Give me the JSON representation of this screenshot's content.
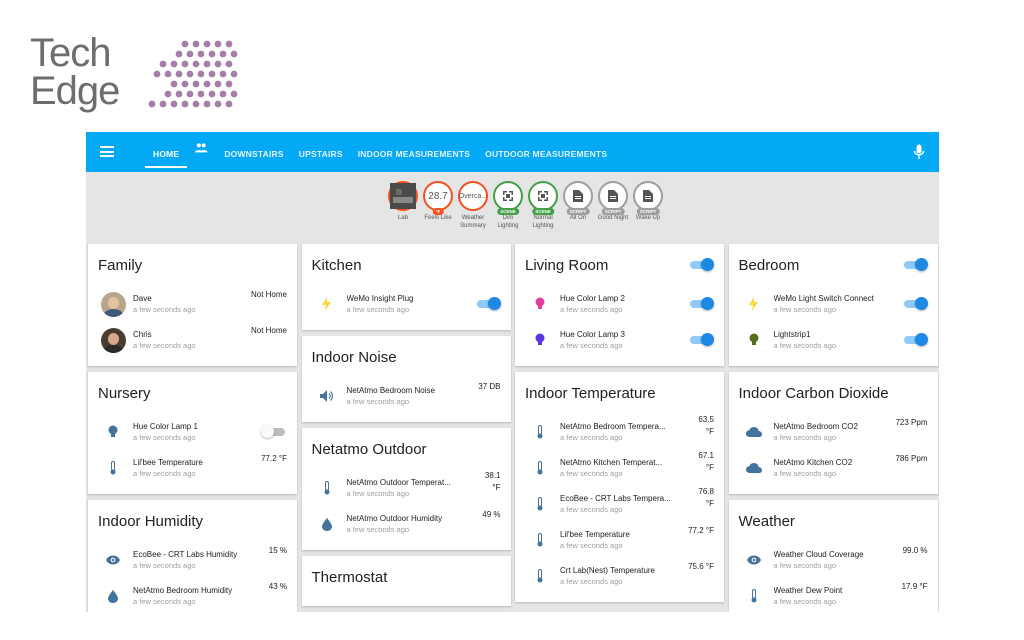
{
  "logo": {
    "line1": "Tech",
    "line2": "Edge"
  },
  "tabs": [
    {
      "label": "HOME"
    },
    {
      "label": "DOWNSTAIRS"
    },
    {
      "label": "UPSTAIRS"
    },
    {
      "label": "INDOOR MEASUREMENTS"
    },
    {
      "label": "OUTDOOR MEASUREMENTS"
    }
  ],
  "badges": [
    {
      "value": "",
      "tag": "",
      "label": "Lab",
      "style": "photo"
    },
    {
      "value": "28.7",
      "tag": "°F",
      "label": "Feels Like",
      "style": "red"
    },
    {
      "value": "Overca...",
      "tag": "",
      "label": "Weather Summary",
      "style": "red"
    },
    {
      "value": "",
      "tag": "SCENE",
      "label": "Dim Lighting",
      "style": "green"
    },
    {
      "value": "",
      "tag": "SCENE",
      "label": "Normal Lighting",
      "style": "green"
    },
    {
      "value": "",
      "tag": "SCRIPT",
      "label": "All On",
      "style": "gray"
    },
    {
      "value": "",
      "tag": "SCRIPT",
      "label": "Good Night",
      "style": "gray"
    },
    {
      "value": "",
      "tag": "SCRIPT",
      "label": "Wake Up",
      "style": "gray"
    }
  ],
  "cards": {
    "family": {
      "title": "Family",
      "rows": [
        {
          "name": "Dave",
          "time": "a few seconds ago",
          "state": "Not Home"
        },
        {
          "name": "Chris",
          "time": "a few seconds ago",
          "state": "Not Home"
        }
      ]
    },
    "nursery": {
      "title": "Nursery",
      "rows": [
        {
          "name": "Hue Color Lamp 1",
          "time": "a few seconds ago",
          "state": "off"
        },
        {
          "name": "Lil'bee Temperature",
          "time": "a few seconds ago",
          "state": "77.2 °F"
        }
      ]
    },
    "humidity": {
      "title": "Indoor Humidity",
      "rows": [
        {
          "name": "EcoBee - CRT Labs Humidity",
          "time": "a few seconds ago",
          "state": "15 %"
        },
        {
          "name": "NetAtmo Bedroom Humidity",
          "time": "a few seconds ago",
          "state": "43 %"
        }
      ]
    },
    "kitchen": {
      "title": "Kitchen",
      "rows": [
        {
          "name": "WeMo Insight Plug",
          "time": "a few seconds ago",
          "state": "on"
        }
      ]
    },
    "noise": {
      "title": "Indoor Noise",
      "rows": [
        {
          "name": "NetAtmo Bedroom Noise",
          "time": "a few seconds ago",
          "state": "37 DB"
        }
      ]
    },
    "outdoor": {
      "title": "Netatmo Outdoor",
      "rows": [
        {
          "name": "NetAtmo Outdoor Temperat...",
          "time": "a few seconds ago",
          "state1": "38.1",
          "state2": "°F"
        },
        {
          "name": "NetAtmo Outdoor Humidity",
          "time": "a few seconds ago",
          "state": "49 %"
        }
      ]
    },
    "thermostat": {
      "title": "Thermostat"
    },
    "living": {
      "title": "Living Room",
      "rows": [
        {
          "name": "Hue Color Lamp 2",
          "time": "a few seconds ago",
          "state": "on"
        },
        {
          "name": "Hue Color Lamp 3",
          "time": "a few seconds ago",
          "state": "on"
        }
      ]
    },
    "indoortemp": {
      "title": "Indoor Temperature",
      "rows": [
        {
          "name": "NetAtmo Bedroom Tempera...",
          "time": "a few seconds ago",
          "state1": "63.5",
          "state2": "°F"
        },
        {
          "name": "NetAtmo Kitchen Temperat...",
          "time": "a few seconds ago",
          "state1": "67.1",
          "state2": "°F"
        },
        {
          "name": "EcoBee - CRT Labs Tempera...",
          "time": "a few seconds ago",
          "state1": "76.8",
          "state2": "°F"
        },
        {
          "name": "Lil'bee Temperature",
          "time": "a few seconds ago",
          "state": "77.2 °F"
        },
        {
          "name": "Crt Lab(Nest) Temperature",
          "time": "a few seconds ago",
          "state": "75.6 °F"
        }
      ]
    },
    "bedroom": {
      "title": "Bedroom",
      "rows": [
        {
          "name": "WeMo Light Switch Connect",
          "time": "a few seconds ago",
          "state": "on"
        },
        {
          "name": "Lightstrip1",
          "time": "a few seconds ago",
          "state": "on"
        }
      ]
    },
    "co2": {
      "title": "Indoor Carbon Dioxide",
      "rows": [
        {
          "name": "NetAtmo Bedroom CO2",
          "time": "a few seconds ago",
          "state": "723 Ppm"
        },
        {
          "name": "NetAtmo Kitchen CO2",
          "time": "a few seconds ago",
          "state": "786 Ppm"
        }
      ]
    },
    "weather": {
      "title": "Weather",
      "rows": [
        {
          "name": "Weather Cloud Coverage",
          "time": "a few seconds ago",
          "state": "99.0 %"
        },
        {
          "name": "Weather Dew Point",
          "time": "a few seconds ago",
          "state": "17.9 °F"
        }
      ]
    }
  },
  "colors": {
    "accent": "#03a9f4",
    "toggle_on": "#1e88e5",
    "logo_text": "#6d6d6d",
    "logo_dots": "#a57ea8"
  }
}
